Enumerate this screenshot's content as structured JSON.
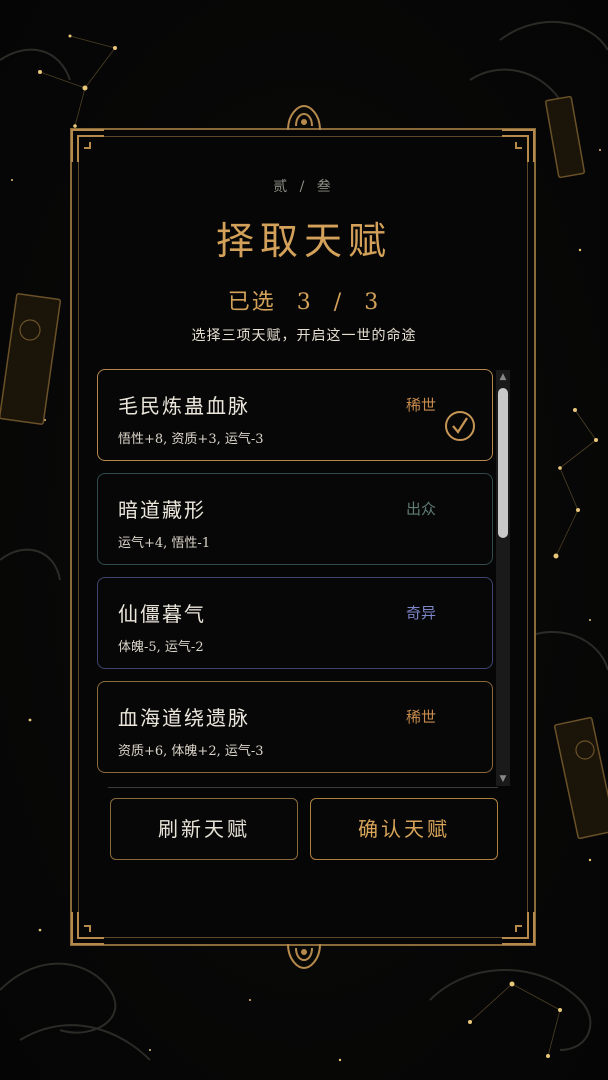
{
  "header": {
    "chapter": "贰 / 叁",
    "title": "择取天赋",
    "selected_label": "已选",
    "selected_count": "3",
    "selected_sep": "/",
    "selected_total": "3",
    "subtitle": "选择三项天赋，开启这一世的命途"
  },
  "talents": [
    {
      "name": "毛民炼蛊血脉",
      "rarity": "稀世",
      "rarity_color": "#c58a4c",
      "stats": "悟性+8, 资质+3, 运气-3",
      "selected": true
    },
    {
      "name": "暗道藏形",
      "rarity": "出众",
      "rarity_color": "#5f7d74",
      "stats": "运气+4, 悟性-1",
      "selected": false
    },
    {
      "name": "仙僵暮气",
      "rarity": "奇异",
      "rarity_color": "#7d86c8",
      "stats": "体魄-5, 运气-2",
      "selected": false
    },
    {
      "name": "血海道绕遗脉",
      "rarity": "稀世",
      "rarity_color": "#c58a4c",
      "stats": "资质+6, 体魄+2, 运气-3",
      "selected": false
    }
  ],
  "actions": {
    "refresh_label": "刷新天赋",
    "confirm_label": "确认天赋"
  },
  "icons": {
    "check": "checkmark-circle-icon",
    "scroll_up": "triangle-up-icon",
    "scroll_down": "triangle-down-icon"
  },
  "colors": {
    "gold": "#d3a15a",
    "frame": "#8a6a38",
    "background": "#050505"
  }
}
